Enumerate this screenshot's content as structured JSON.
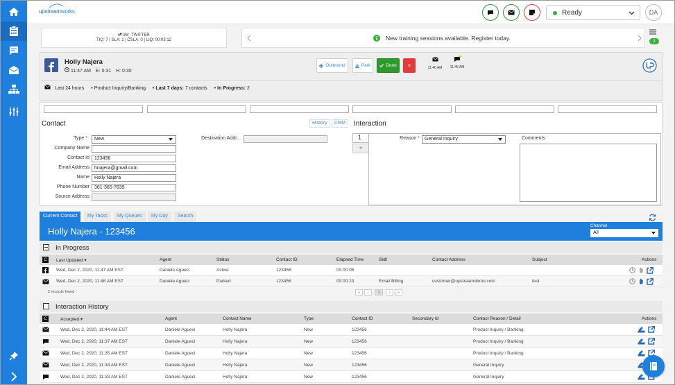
{
  "app": {
    "logo_prefix": "upstream",
    "logo_suffix": "works"
  },
  "rail": {
    "items": [
      "home-icon",
      "clipboard-icon",
      "chat-icon",
      "mail-icon",
      "org-chart-icon",
      "sliders-icon"
    ],
    "bottom": [
      "pin-icon",
      "chevron-right-icon"
    ]
  },
  "topbar": {
    "status": "Ready",
    "avatar": "DA"
  },
  "queue": {
    "name": "UM_TWITTER",
    "stats": "TIQ: 7 | SLA: 1 | CSLA: 0 | LIQ: 00:03:12"
  },
  "notice": {
    "text": "New training sessions available. Register today.",
    "badge": "2"
  },
  "contact": {
    "name": "Holly Najera",
    "time": "11:47 AM",
    "e": "E: 0:31",
    "h": "H: 0:30",
    "buttons": {
      "outbound": "Outbound",
      "park": "Park",
      "done": "Done",
      "close": "×"
    },
    "mini": [
      {
        "time": "11:46 AM"
      },
      {
        "time": "11:46 AM"
      }
    ],
    "summary": {
      "last24": "Last 24 hours",
      "item1": "Product Inquiry/Banking",
      "last7_label": "Last 7 days:",
      "last7_value": "7 contacts",
      "inprog_label": "In Progress:",
      "inprog_value": "2"
    }
  },
  "form": {
    "contact_title": "Contact",
    "history_btn": "History",
    "crm_btn": "CRM",
    "fields": {
      "type_label": "Type",
      "type_value": "New",
      "company_label": "Company Name",
      "company_value": "",
      "contactid_label": "Contact Id",
      "contactid_value": "123456",
      "email_label": "Email Address",
      "email_value": "hnajera@gmail.com",
      "name_label": "Name",
      "name_value": "Holly Najera",
      "phone_label": "Phone Number",
      "phone_value": "361-365-7835",
      "source_label": "Source Address",
      "source_value": "",
      "dest_label": "Destination Addr...",
      "dest_value": ""
    },
    "interaction_title": "Interaction",
    "interaction_num": "1",
    "add": "+",
    "reason_label": "Reason",
    "reason_value": "General Inquiry",
    "comments_label": "Comments"
  },
  "tabs": [
    "Current Contact",
    "My Tasks",
    "My Queues",
    "My Day",
    "Search"
  ],
  "banner": {
    "title": "Holly Najera - 123456",
    "channel_label": "Channel",
    "channel_value": "All"
  },
  "inprogress": {
    "title": "In Progress",
    "headers": {
      "c": "C",
      "updated": "Last Updated ▾",
      "agent": "Agent",
      "status": "Status",
      "cid": "Contact ID",
      "elapsed": "Elapsed Time",
      "skill": "Skill",
      "addr": "Contact Address",
      "subject": "Subject",
      "actions": "Actions"
    },
    "rows": [
      {
        "icon": "facebook-icon",
        "updated": "Wed, Dec 2, 2020, 11:47 AM EST",
        "agent": "Daniele Agueci",
        "status": "Active",
        "cid": "123456",
        "elapsed": "00:00:06",
        "skill": "",
        "addr": "",
        "subject": ""
      },
      {
        "icon": "mail-icon",
        "updated": "Wed, Dec 2, 2020, 11:46 AM EST",
        "agent": "Daniele Agueci",
        "status": "Parked",
        "cid": "123456",
        "elapsed": "00:00:23",
        "skill": "Email Billing",
        "addr": "customer@upstreamdemo.com",
        "subject": "test"
      }
    ],
    "found": "2 records found",
    "pager": [
      "«",
      "‹",
      "1",
      "›",
      "»"
    ]
  },
  "history": {
    "title": "Interaction History",
    "headers": {
      "c": "C",
      "accepted": "Accepted ▾",
      "agent": "Agent",
      "cname": "Contact Name",
      "type": "Type",
      "cid": "Contact ID",
      "sid": "Secondary Id",
      "reason": "Contact Reason / Detail",
      "actions": "Actions"
    },
    "rows": [
      {
        "icon": "mail-icon",
        "accepted": "Wed, Dec 2, 2020, 11:44 AM EST",
        "agent": "Daniele Agueci",
        "cname": "Holly Najera",
        "type": "New",
        "cid": "123456",
        "sid": "",
        "reason": "Product Inquiry / Banking"
      },
      {
        "icon": "chat-icon",
        "accepted": "Wed, Dec 2, 2020, 11:37 AM EST",
        "agent": "Daniele Agueci",
        "cname": "Holly Najera",
        "type": "New",
        "cid": "123456",
        "sid": "",
        "reason": "Product Inquiry / Banking"
      },
      {
        "icon": "mail-icon",
        "accepted": "Wed, Dec 2, 2020, 11:35 AM EST",
        "agent": "Daniele Agueci",
        "cname": "Holly Najera",
        "type": "New",
        "cid": "123456",
        "sid": "",
        "reason": "Product Inquiry / Banking"
      },
      {
        "icon": "mail-icon",
        "accepted": "Wed, Dec 2, 2020, 11:34 AM EST",
        "agent": "Daniele Agueci",
        "cname": "Holly Najera",
        "type": "New",
        "cid": "123456",
        "sid": "",
        "reason": "General Inquiry"
      },
      {
        "icon": "chat-icon",
        "accepted": "Wed, Dec 2, 2020, 11:33 AM EST",
        "agent": "Daniele Agueci",
        "cname": "Holly Najera",
        "type": "New",
        "cid": "123456",
        "sid": "",
        "reason": "General Inquiry"
      }
    ]
  },
  "colors": {
    "primary": "#1f7fdc",
    "done": "#2e9a2e",
    "close": "#e23b3b"
  }
}
